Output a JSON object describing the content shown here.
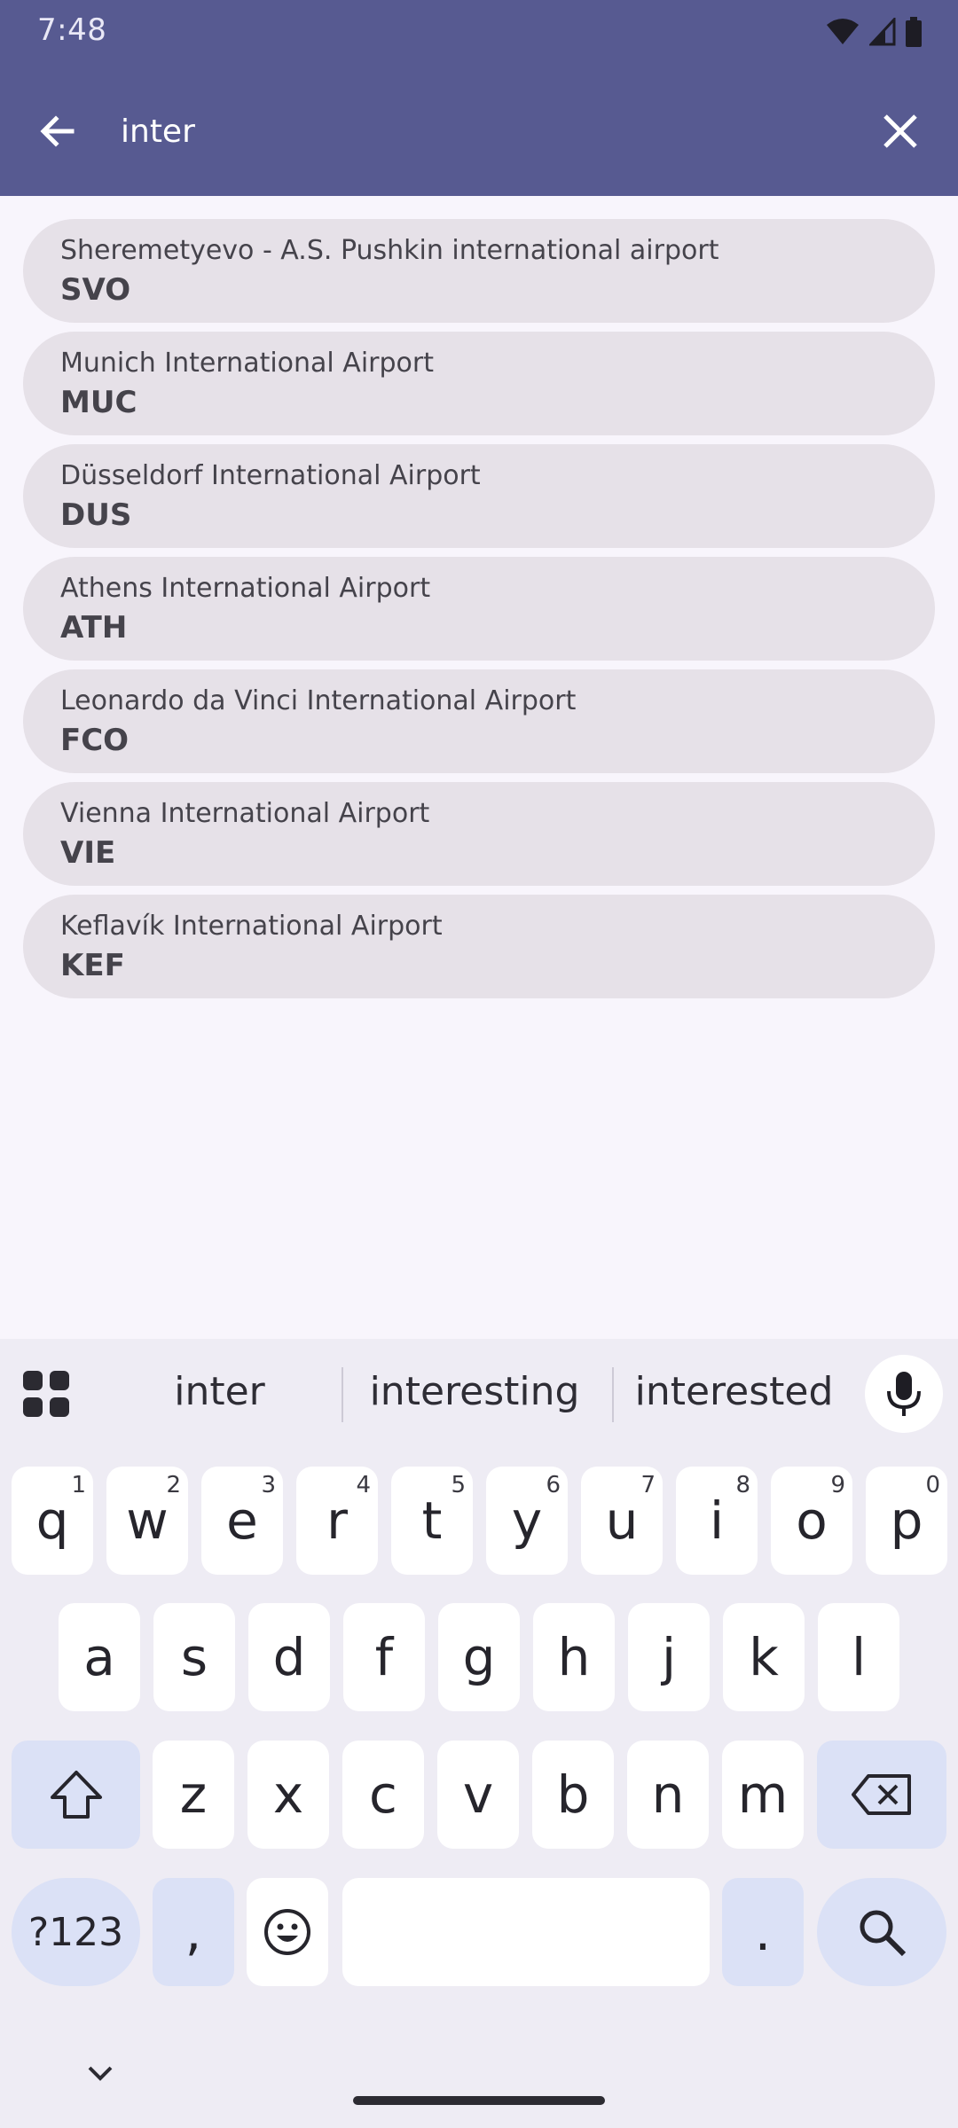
{
  "status_bar": {
    "time": "7:48"
  },
  "search": {
    "value": "inter",
    "back_icon": "arrow-left-icon",
    "clear_icon": "close-icon"
  },
  "results": [
    {
      "name": "Sheremetyevo - A.S. Pushkin international airport",
      "code": "SVO"
    },
    {
      "name": "Munich International Airport",
      "code": "MUC"
    },
    {
      "name": "Düsseldorf International Airport",
      "code": "DUS"
    },
    {
      "name": "Athens International Airport",
      "code": "ATH"
    },
    {
      "name": "Leonardo da Vinci International Airport",
      "code": "FCO"
    },
    {
      "name": "Vienna International Airport",
      "code": "VIE"
    },
    {
      "name": "Keflavík International Airport",
      "code": "KEF"
    }
  ],
  "keyboard": {
    "suggestions": [
      "inter",
      "interesting",
      "interested"
    ],
    "row1": [
      {
        "key": "q",
        "hint": "1"
      },
      {
        "key": "w",
        "hint": "2"
      },
      {
        "key": "e",
        "hint": "3"
      },
      {
        "key": "r",
        "hint": "4"
      },
      {
        "key": "t",
        "hint": "5"
      },
      {
        "key": "y",
        "hint": "6"
      },
      {
        "key": "u",
        "hint": "7"
      },
      {
        "key": "i",
        "hint": "8"
      },
      {
        "key": "o",
        "hint": "9"
      },
      {
        "key": "p",
        "hint": "0"
      }
    ],
    "row2": [
      "a",
      "s",
      "d",
      "f",
      "g",
      "h",
      "j",
      "k",
      "l"
    ],
    "row3": [
      "z",
      "x",
      "c",
      "v",
      "b",
      "n",
      "m"
    ],
    "symbols_label": "?123",
    "comma": ",",
    "period": "."
  },
  "colors": {
    "app_bar": "#575a91",
    "result_bg": "#e6e1e8",
    "keyboard_bg": "#eeecf4",
    "modifier_key": "#dbe1f6"
  }
}
